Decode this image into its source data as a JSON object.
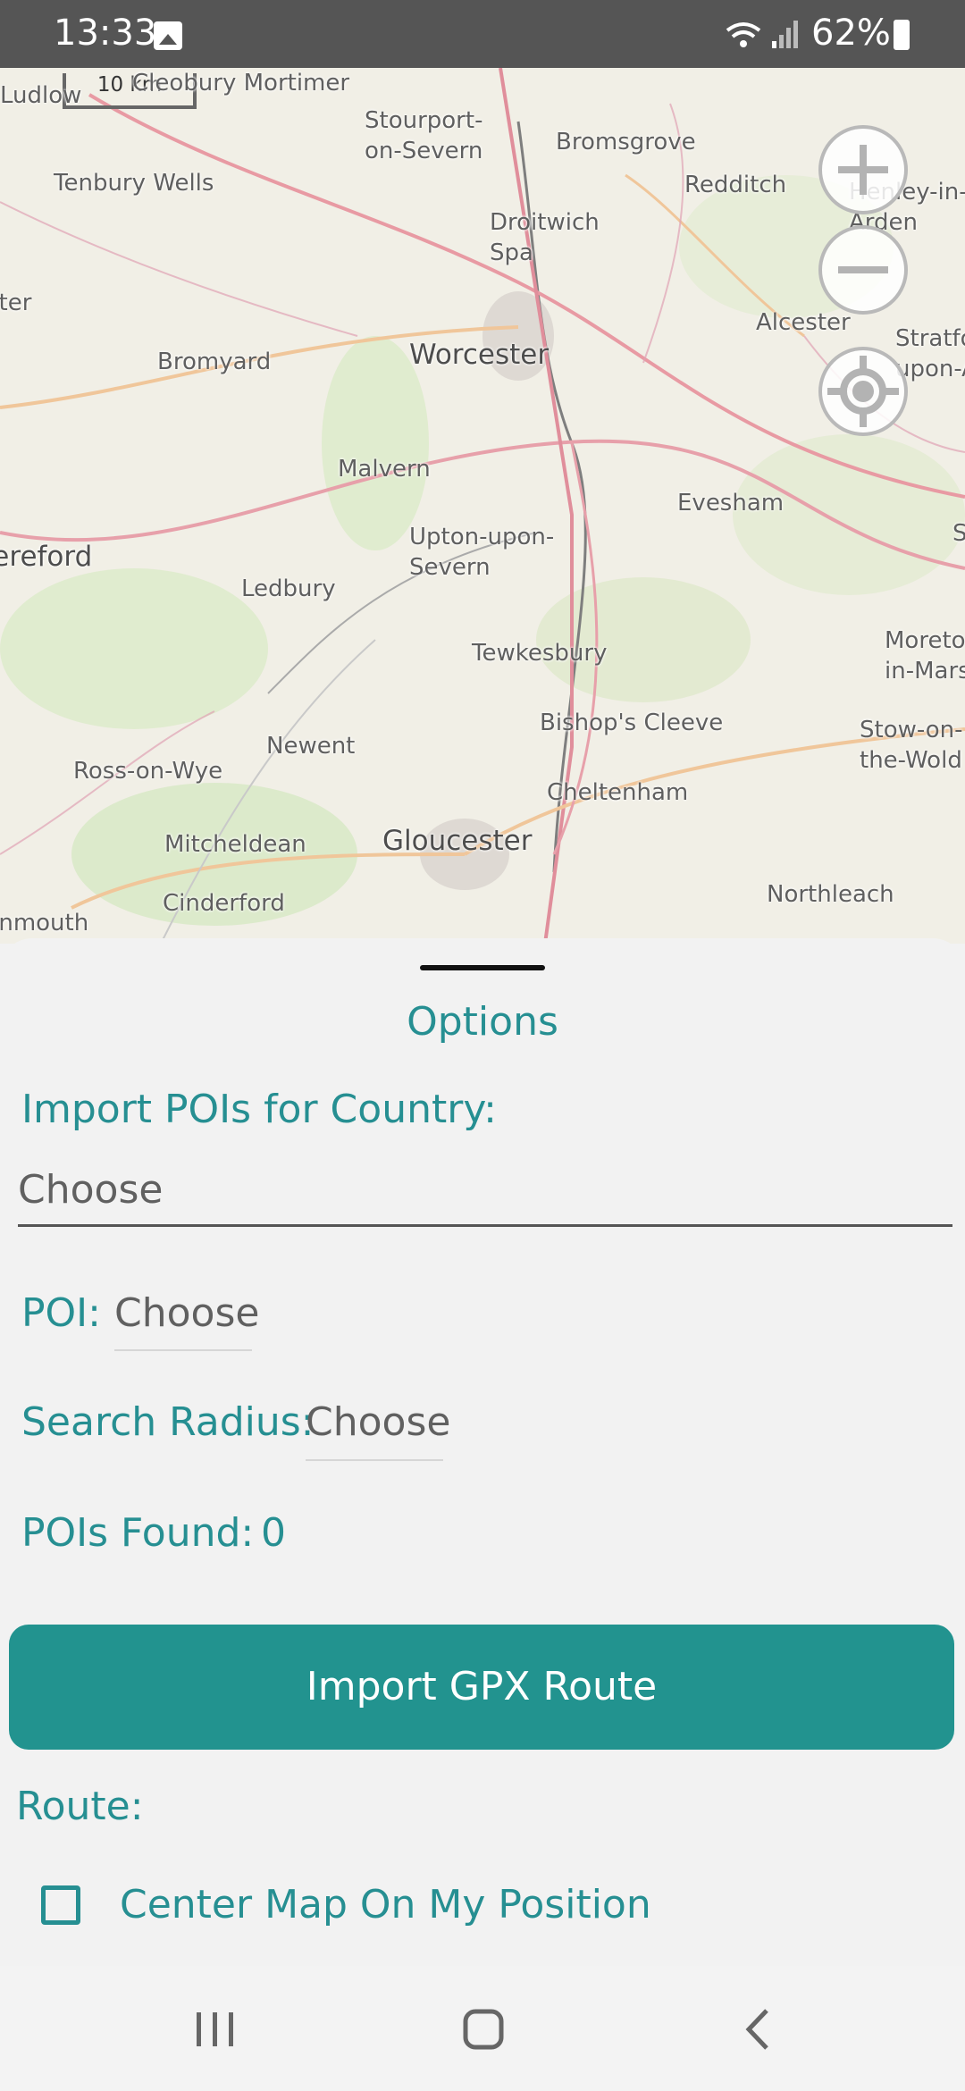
{
  "status_bar": {
    "time": "13:33",
    "battery": "62%"
  },
  "map": {
    "scale_label": "10 km",
    "towns": [
      "Cleobury Mortimer",
      "Ludlow",
      "Stourport-\non-Severn",
      "Bromsgrove",
      "Redditch",
      "Tenbury Wells",
      "Droitwich\nSpa",
      "Henley-in-\nArden",
      "Alcester",
      "Stratford-\nupon-A",
      "Leominster",
      "Bromyard",
      "Worcester",
      "Malvern",
      "Evesham",
      "Hereford",
      "Upton-upon-\nSevern",
      "Ledbury",
      "Tewkesbury",
      "Moreton-\nin-Marsh",
      "Bishop's Cleeve",
      "Stow-on-\nthe-Wold",
      "Newent",
      "Ross-on-Wye",
      "Cheltenham",
      "Mitcheldean",
      "Gloucester",
      "Northleach",
      "Cinderford",
      "Monmouth",
      "Shipston"
    ]
  },
  "sheet": {
    "title": "Options",
    "import_country_label": "Import POIs for Country:",
    "country_value": "Choose",
    "poi_label": "POI:",
    "poi_value": "Choose",
    "radius_label": "Search Radius:",
    "radius_value": "Choose",
    "found_label": "POIs Found:",
    "found_value": "0",
    "import_button": "Import GPX Route",
    "route_label": "Route:",
    "center_checkbox_label": "Center Map On My Position"
  },
  "colors": {
    "accent": "#268f92",
    "button": "#22938f",
    "status_bar": "#555555"
  }
}
